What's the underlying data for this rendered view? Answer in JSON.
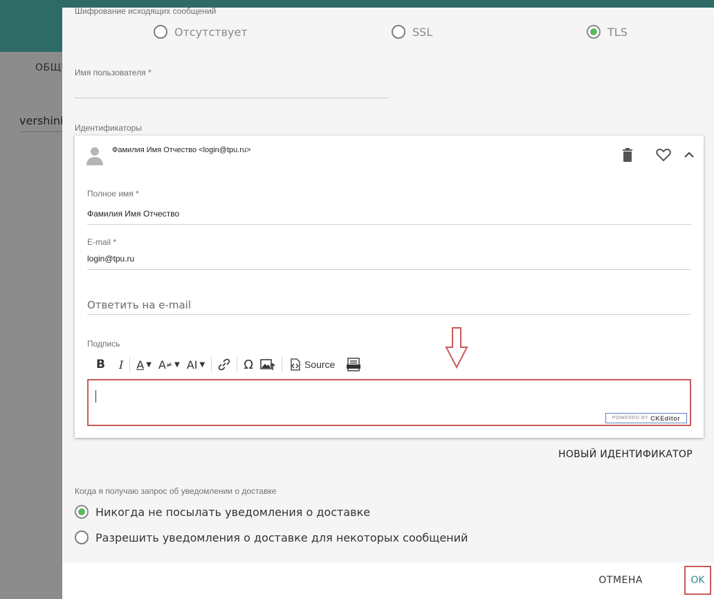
{
  "background": {
    "tab_label": "ОБЩЕ",
    "user_text": "vershinin"
  },
  "dialog": {
    "encryption": {
      "label": "Шифрование исходящих сообщений",
      "options": [
        "Отсутствует",
        "SSL",
        "TLS"
      ],
      "selected": "TLS"
    },
    "username": {
      "label": "Имя пользователя *",
      "value": ""
    },
    "identities_label": "Идентификаторы",
    "identity_card": {
      "title": "Фамилия Имя Отчество <login@tpu.ru>",
      "icons": [
        "trash-icon",
        "heart-icon",
        "chevron-up-icon"
      ],
      "full_name": {
        "label": "Полное имя *",
        "value": "Фамилия Имя Отчество"
      },
      "email": {
        "label": "E-mail *",
        "value": "login@tpu.ru"
      },
      "reply_to": {
        "placeholder": "Ответить на e-mail"
      },
      "signature": {
        "label": "Подпись",
        "toolbar": {
          "bold": "B",
          "italic": "I",
          "font_color": "A",
          "font_size": "A",
          "font_family": "AI",
          "special_chars": "Ω",
          "source_label": "Source"
        },
        "powered_by": "POWERED BY",
        "powered_brand": "CKEditor"
      }
    },
    "new_identity_label": "НОВЫЙ ИДЕНТИФИКАТОР",
    "receipt": {
      "label": "Когда я получаю запрос об уведомлении о доставке",
      "options": [
        "Никогда не посылать уведомления о доставке",
        "Разрешить уведомления о доставке для некоторых сообщений"
      ],
      "selected_index": 0
    },
    "footer": {
      "cancel_label": "ОТМЕНА",
      "ok_label": "OK"
    }
  },
  "colors": {
    "accent_teal": "#2e6b66",
    "radio_green": "#5cb85c",
    "highlight_red": "#c9595a"
  }
}
